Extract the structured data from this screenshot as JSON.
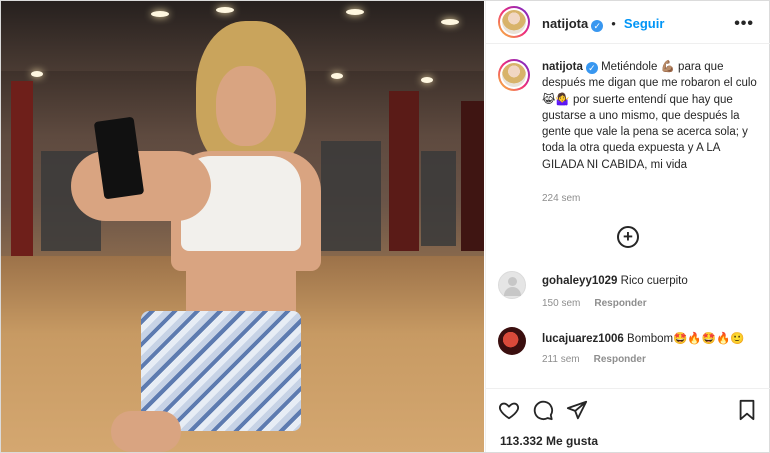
{
  "post": {
    "username": "natijota",
    "follow_label": "Seguir",
    "more_label": "•••",
    "verified_mark": "✓"
  },
  "caption": {
    "username": "natijota",
    "text": "Metiéndole 💪🏽 para que después me digan que me robaron el culo 😹🤷‍♀️ por suerte entendí que hay que gustarse a uno mismo, que después la gente que vale la pena se acerca sola; y toda la otra queda expuesta y A LA GILADA NI CABIDA, mi vida",
    "time": "224 sem"
  },
  "load_more": "+",
  "comments": [
    {
      "username": "gohaleyy1029",
      "text": "Rico cuerpito",
      "time": "150 sem",
      "reply": "Responder"
    },
    {
      "username": "lucajuarez1006",
      "text": "Bombom🤩🔥🤩🔥🙂",
      "time": "211 sem",
      "reply": "Responder"
    }
  ],
  "likes": "113.332 Me gusta",
  "icons": [
    "heart-icon",
    "comment-icon",
    "share-icon",
    "bookmark-icon",
    "more-icon",
    "plus-circle-icon",
    "verified-icon"
  ],
  "colors": {
    "accent": "#0095f6",
    "verified": "#3897f0",
    "muted": "#8e8e8e",
    "text": "#262626"
  }
}
